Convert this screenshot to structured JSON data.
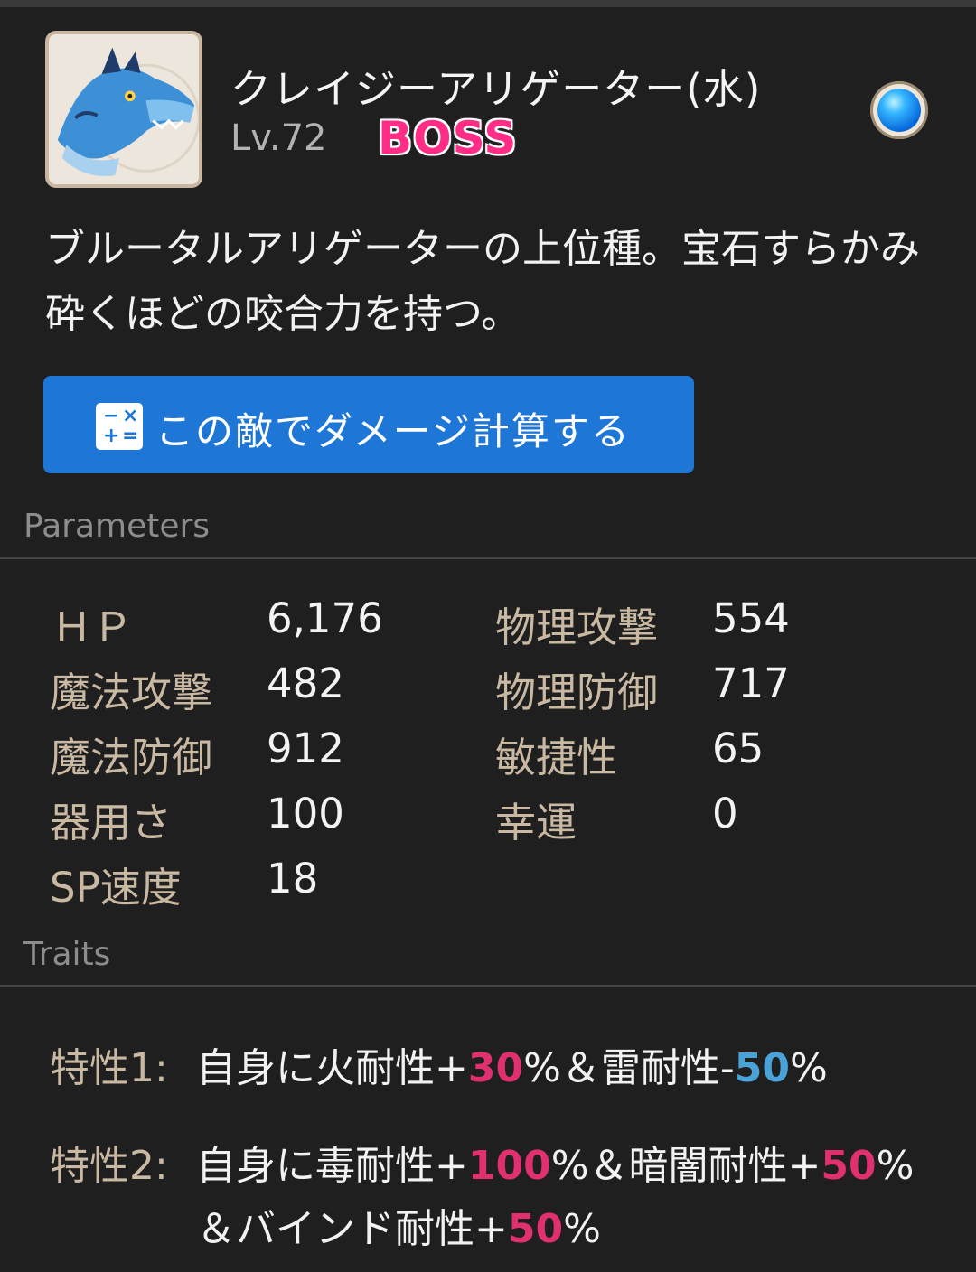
{
  "monster": {
    "name": "クレイジーアリゲーター(水)",
    "level": "Lv.72",
    "badge": "BOSS",
    "description": "ブルータルアリゲーターの上位種。宝石すらかみ砕くほどの咬合力を持つ。",
    "element_orb": {
      "icon": "water-element-icon",
      "color": "#1f8cf0"
    }
  },
  "actions": {
    "calc_button_label": "この敵でダメージ計算する",
    "calc_icon": "calculator-icon"
  },
  "parameters": {
    "section_title": "Parameters",
    "left": [
      {
        "label": "ＨＰ",
        "value": "6,176"
      },
      {
        "label": "魔法攻撃",
        "value": "482"
      },
      {
        "label": "魔法防御",
        "value": "912"
      },
      {
        "label": "器用さ",
        "value": "100"
      },
      {
        "label": "SP速度",
        "value": "18"
      }
    ],
    "right": [
      {
        "label": "物理攻撃",
        "value": "554"
      },
      {
        "label": "物理防御",
        "value": "717"
      },
      {
        "label": "敏捷性",
        "value": "65"
      },
      {
        "label": "幸運",
        "value": "0"
      }
    ]
  },
  "traits": {
    "section_title": "Traits",
    "items": [
      {
        "label": "特性1:",
        "lines": [
          [
            {
              "text": "自身に火耐性+",
              "style": "normal"
            },
            {
              "text": "30",
              "style": "pos"
            },
            {
              "text": "%＆雷耐性-",
              "style": "normal"
            },
            {
              "text": "50",
              "style": "neg"
            },
            {
              "text": "%",
              "style": "normal"
            }
          ]
        ]
      },
      {
        "label": "特性2:",
        "lines": [
          [
            {
              "text": "自身に毒耐性+",
              "style": "normal"
            },
            {
              "text": "100",
              "style": "pos"
            },
            {
              "text": "%＆暗闇耐性+",
              "style": "normal"
            },
            {
              "text": "50",
              "style": "pos"
            },
            {
              "text": "%",
              "style": "normal"
            }
          ],
          [
            {
              "text": "＆バインド耐性+",
              "style": "normal"
            },
            {
              "text": "50",
              "style": "pos"
            },
            {
              "text": "%",
              "style": "normal"
            }
          ]
        ]
      }
    ]
  },
  "colors": {
    "background": "#1f1f1f",
    "label": "#c9b8a2",
    "accent_button": "#1e77d7",
    "boss": "#ff2d86",
    "positive": "#e0306f",
    "negative": "#4aa3d8"
  }
}
